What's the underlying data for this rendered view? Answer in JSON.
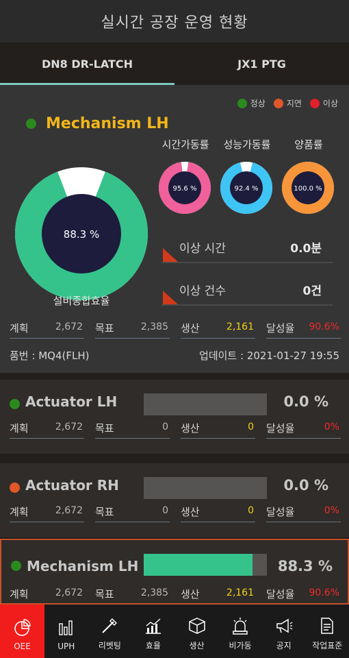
{
  "header": {
    "title": "실시간 공장 운영 현황"
  },
  "tabs": [
    {
      "label": "DN8 DR-LATCH"
    },
    {
      "label": "JX1 PTG"
    }
  ],
  "legend": [
    {
      "label": "정상",
      "color": "#2a8a1e"
    },
    {
      "label": "지연",
      "color": "#e0572a"
    },
    {
      "label": "이상",
      "color": "#e0202a"
    }
  ],
  "main": {
    "line_name": "Mechanism LH",
    "status_color": "#2a8a1e",
    "oee": {
      "value": 88.3,
      "label": "88.3 %",
      "caption": "설비종합효율",
      "color": "#35c38b"
    },
    "kpis": [
      {
        "label": "시간가동률",
        "value": 95.6,
        "text": "95.6 %",
        "color": "#f0609a"
      },
      {
        "label": "성능가동률",
        "value": 92.4,
        "text": "92.4 %",
        "color": "#3ec5f5"
      },
      {
        "label": "양품률",
        "value": 100.0,
        "text": "100.0 %",
        "color": "#f7953a"
      }
    ],
    "abnormal_time": {
      "label": "이상 시간",
      "value": "0.0분"
    },
    "abnormal_count": {
      "label": "이상 건수",
      "value": "0건"
    },
    "stats": {
      "plan": {
        "label": "계획",
        "value": "2,672"
      },
      "target": {
        "label": "목표",
        "value": "2,385"
      },
      "production": {
        "label": "생산",
        "value": "2,161"
      },
      "achievement": {
        "label": "달성율",
        "value": "90.6%"
      }
    },
    "part_no": "품번 : MQ4(FLH)",
    "updated": "업데이트 : 2021-01-27 19:55"
  },
  "cards": [
    {
      "name": "Actuator LH",
      "status_color": "#2a8a1e",
      "progress": 0.0,
      "pct": "0.0 %",
      "plan_label": "계획",
      "plan": "2,672",
      "target_label": "목표",
      "target": "0",
      "prod_label": "생산",
      "prod": "0",
      "ach_label": "달성율",
      "ach": "0%"
    },
    {
      "name": "Actuator RH",
      "status_color": "#e0572a",
      "progress": 0.0,
      "pct": "0.0 %",
      "plan_label": "계획",
      "plan": "2,672",
      "target_label": "목표",
      "target": "0",
      "prod_label": "생산",
      "prod": "0",
      "ach_label": "달성율",
      "ach": "0%"
    },
    {
      "name": "Mechanism LH",
      "status_color": "#2a8a1e",
      "progress": 88.3,
      "pct": "88.3 %",
      "plan_label": "계획",
      "plan": "2,672",
      "target_label": "목표",
      "target": "2,385",
      "prod_label": "생산",
      "prod": "2,161",
      "ach_label": "달성율",
      "ach": "90.6%"
    }
  ],
  "nav": [
    {
      "label": "OEE",
      "icon": "oee-icon"
    },
    {
      "label": "UPH",
      "icon": "bar-chart-icon"
    },
    {
      "label": "리벳팅",
      "icon": "riveting-icon"
    },
    {
      "label": "효율",
      "icon": "trend-chart-icon"
    },
    {
      "label": "생산",
      "icon": "box-icon"
    },
    {
      "label": "비가동",
      "icon": "siren-icon"
    },
    {
      "label": "공지",
      "icon": "megaphone-icon"
    },
    {
      "label": "작업표준",
      "icon": "document-icon"
    }
  ]
}
